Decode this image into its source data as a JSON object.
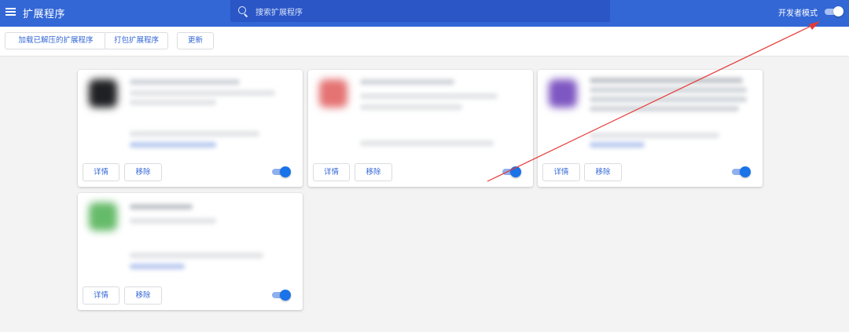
{
  "header": {
    "title": "扩展程序",
    "search_placeholder": "搜索扩展程序",
    "developer_mode_label": "开发者模式",
    "developer_mode_on": true,
    "bg_color": "#3367d6"
  },
  "toolbar": {
    "load_unpacked": "加载已解压的扩展程序",
    "pack_extension": "打包扩展程序",
    "update": "更新"
  },
  "cards": [
    {
      "details": "详情",
      "remove": "移除",
      "enabled": true,
      "icon_color": "#202124"
    },
    {
      "details": "详情",
      "remove": "移除",
      "enabled": true,
      "icon_color": "#e57373"
    },
    {
      "details": "详情",
      "remove": "移除",
      "enabled": true,
      "icon_color": "#7e57c2"
    },
    {
      "details": "详情",
      "remove": "移除",
      "enabled": true,
      "icon_color": "#66bb6a"
    }
  ],
  "annotation": {
    "color": "#e53935"
  }
}
